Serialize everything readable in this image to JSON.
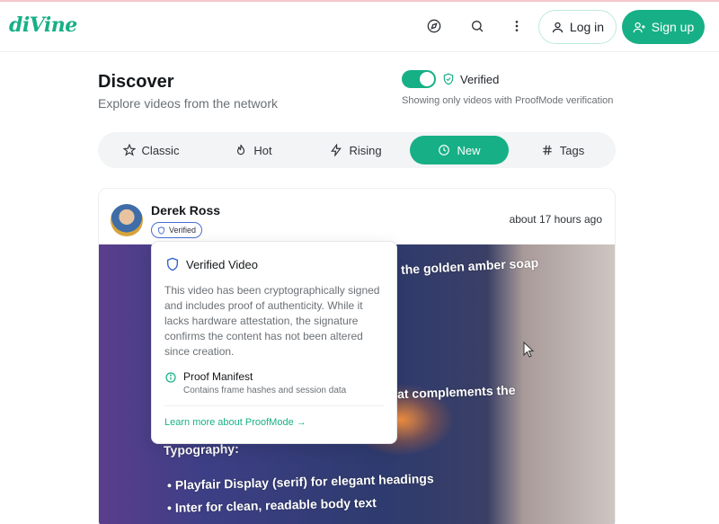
{
  "app": {
    "logo": "diVine"
  },
  "header": {
    "icons": [
      "compass-icon",
      "search-icon",
      "more-vertical-icon"
    ],
    "login_label": "Log in",
    "signup_label": "Sign up"
  },
  "page": {
    "title": "Discover",
    "subtitle": "Explore videos from the network"
  },
  "filter": {
    "toggle_on": true,
    "verified_label": "Verified",
    "note": "Showing only videos with ProofMode verification"
  },
  "tabs": [
    {
      "label": "Classic",
      "icon": "star-icon",
      "active": false
    },
    {
      "label": "Hot",
      "icon": "flame-icon",
      "active": false
    },
    {
      "label": "Rising",
      "icon": "zap-icon",
      "active": false
    },
    {
      "label": "New",
      "icon": "clock-icon",
      "active": true
    },
    {
      "label": "Tags",
      "icon": "hash-icon",
      "active": false
    }
  ],
  "post": {
    "author": "Derek Ross",
    "badge": "Verified",
    "time": "about 17 hours ago",
    "video_lines": [
      "the golden amber soap",
      "at complements the",
      "Typography:",
      "•  Playfair Display (serif) for elegant headings",
      "•  Inter for clean, readable body text"
    ]
  },
  "popover": {
    "title": "Verified Video",
    "body": "This video has been cryptographically signed and includes proof of authenticity. While it lacks hardware attestation, the signature confirms the content has not been altered since creation.",
    "manifest_title": "Proof Manifest",
    "manifest_sub": "Contains frame hashes and session data",
    "link": "Learn more about ProofMode →"
  },
  "colors": {
    "accent": "#17b086",
    "badge_border": "#4a6fd6"
  }
}
